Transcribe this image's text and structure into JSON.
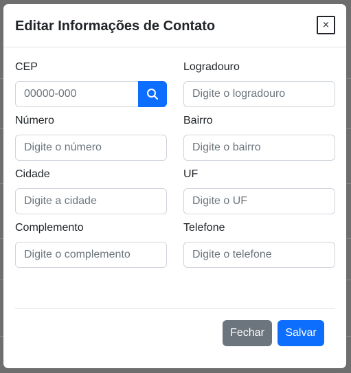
{
  "modal": {
    "title": "Editar Informações de Contato",
    "close_label": "×"
  },
  "fields": {
    "cep": {
      "label": "CEP",
      "placeholder": "00000-000",
      "value": ""
    },
    "logradouro": {
      "label": "Logradouro",
      "placeholder": "Digite o logradouro",
      "value": ""
    },
    "numero": {
      "label": "Número",
      "placeholder": "Digite o número",
      "value": ""
    },
    "bairro": {
      "label": "Bairro",
      "placeholder": "Digite o bairro",
      "value": ""
    },
    "cidade": {
      "label": "Cidade",
      "placeholder": "Digite a cidade",
      "value": ""
    },
    "uf": {
      "label": "UF",
      "placeholder": "Digite o UF",
      "value": ""
    },
    "complemento": {
      "label": "Complemento",
      "placeholder": "Digite o complemento",
      "value": ""
    },
    "telefone": {
      "label": "Telefone",
      "placeholder": "Digite o telefone",
      "value": ""
    }
  },
  "search_button": {
    "icon": "search-icon"
  },
  "footer": {
    "close_button": "Fechar",
    "save_button": "Salvar"
  },
  "colors": {
    "primary": "#0d6efd",
    "secondary": "#6c757d",
    "backdrop": "#6e6e6e"
  }
}
